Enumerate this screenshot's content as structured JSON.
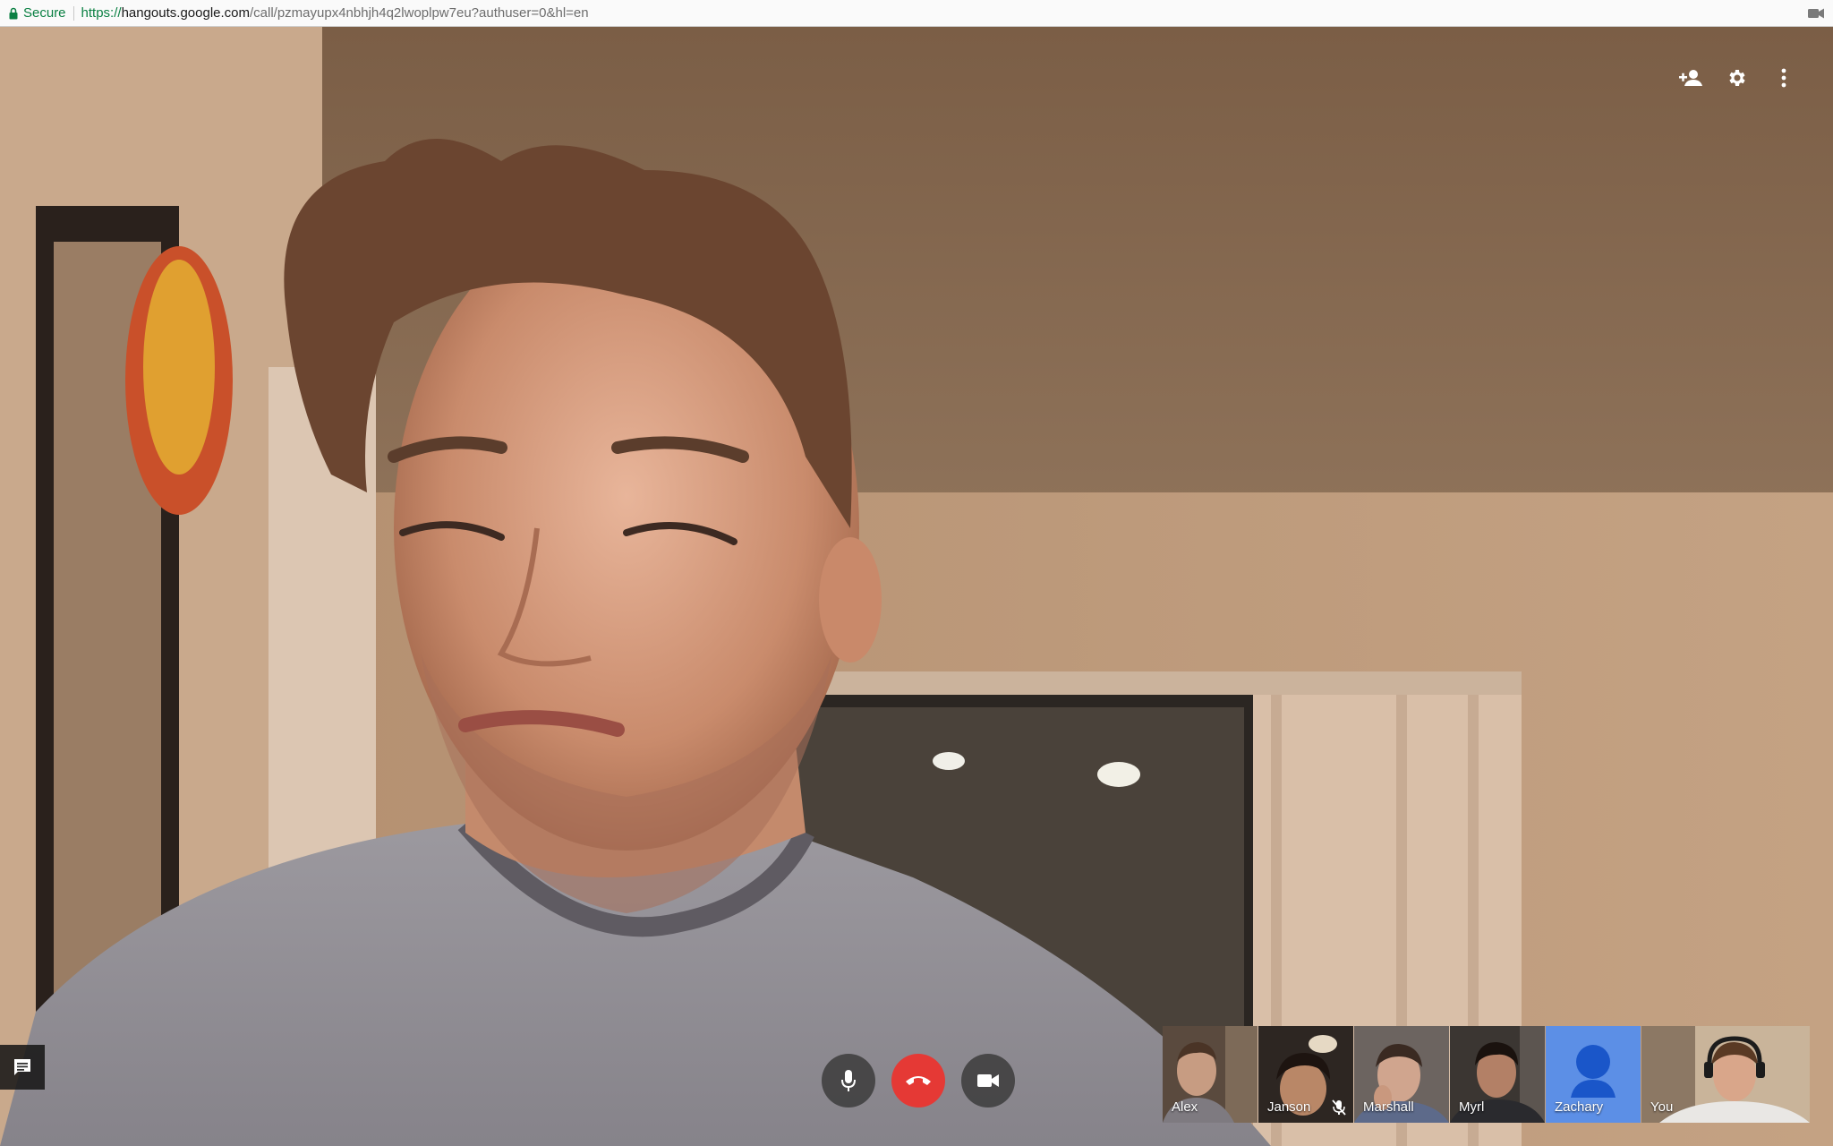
{
  "address_bar": {
    "secure_label": "Secure",
    "url_scheme": "https://",
    "url_host": "hangouts.google.com",
    "url_path": "/call/pzmayupx4nbhjh4q2lwoplpw7eu?authuser=0&hl=en"
  },
  "top_actions": {
    "icons": [
      "add-person-icon",
      "gear-icon",
      "more-vert-icon"
    ]
  },
  "controls": {
    "icons": [
      "microphone-icon",
      "hang-up-icon",
      "video-camera-icon"
    ],
    "hangup_color": "#e53935"
  },
  "chat": {
    "icon": "chat-icon"
  },
  "participants": [
    {
      "name": "Alex"
    },
    {
      "name": "Janson",
      "muted": true
    },
    {
      "name": "Marshall"
    },
    {
      "name": "Myrl"
    },
    {
      "name": "Zachary",
      "avatar_color": "#5c8fe6"
    },
    {
      "name": "You"
    }
  ]
}
